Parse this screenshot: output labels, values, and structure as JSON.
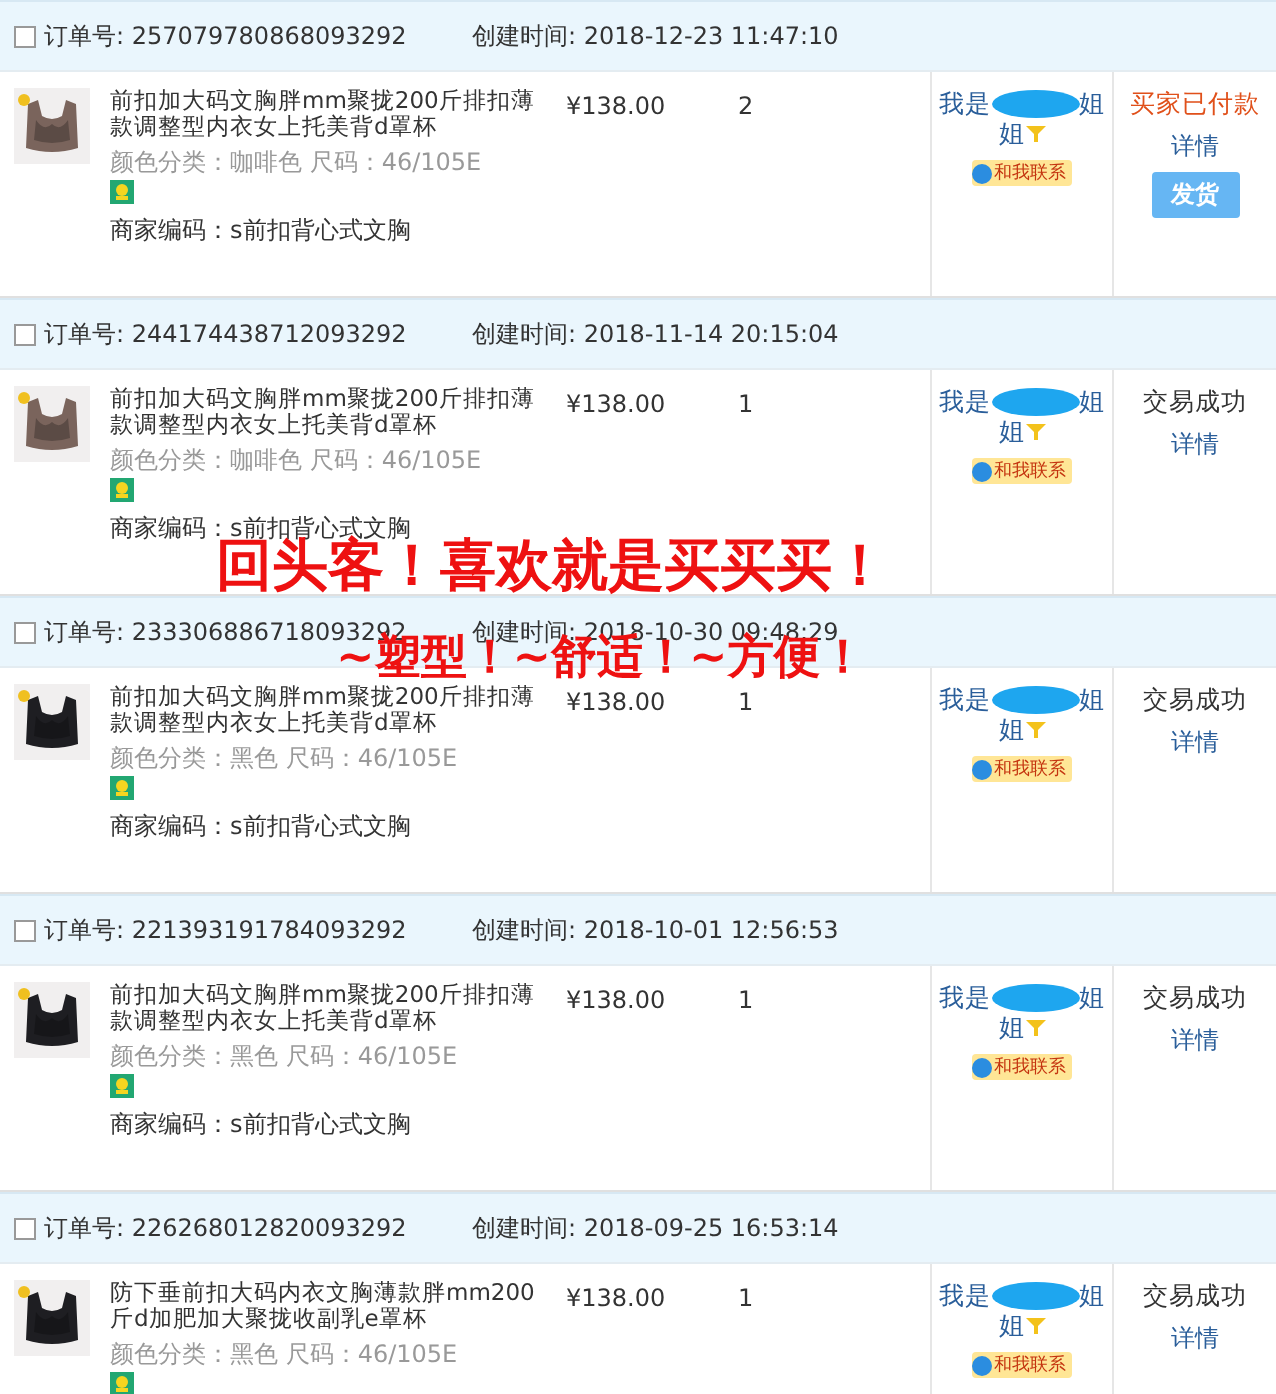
{
  "orders": [
    {
      "checked": false,
      "order_label": "订单号:",
      "order_no": "257079780868093292",
      "created_label": "创建时间:",
      "created": "2018-12-23 11:47:10",
      "product": {
        "title": "前扣加大码文胸胖mm聚拢200斤排扣薄款调整型内衣女上托美背d罩杯",
        "color": "#7a645c",
        "spec": "颜色分类：咖啡色  尺码：46/105E",
        "merchant_code": "商家编码：s前扣背心式文胸"
      },
      "price": "¥138.00",
      "qty": "2",
      "buyer": {
        "prefix": "我是",
        "suffix": "姐",
        "line2": "姐",
        "contact": "和我联系"
      },
      "status": {
        "kind": "paid",
        "text": "买家已付款",
        "detail": "详情",
        "action": "发货"
      }
    },
    {
      "checked": false,
      "order_label": "订单号:",
      "order_no": "244174438712093292",
      "created_label": "创建时间:",
      "created": "2018-11-14 20:15:04",
      "product": {
        "title": "前扣加大码文胸胖mm聚拢200斤排扣薄款调整型内衣女上托美背d罩杯",
        "color": "#7a645c",
        "spec": "颜色分类：咖啡色  尺码：46/105E",
        "merchant_code": "商家编码：s前扣背心式文胸"
      },
      "price": "¥138.00",
      "qty": "1",
      "buyer": {
        "prefix": "我是",
        "suffix": "姐",
        "line2": "姐",
        "contact": "和我联系"
      },
      "status": {
        "kind": "done",
        "text": "交易成功",
        "detail": "详情"
      }
    },
    {
      "checked": false,
      "order_label": "订单号:",
      "order_no": "233306886718093292",
      "created_label": "创建时间:",
      "created": "2018-10-30 09:48:29",
      "product": {
        "title": "前扣加大码文胸胖mm聚拢200斤排扣薄款调整型内衣女上托美背d罩杯",
        "color": "#1e1e22",
        "spec": "颜色分类：黑色  尺码：46/105E",
        "merchant_code": "商家编码：s前扣背心式文胸"
      },
      "price": "¥138.00",
      "qty": "1",
      "buyer": {
        "prefix": "我是",
        "suffix": "姐",
        "line2": "姐",
        "contact": "和我联系"
      },
      "status": {
        "kind": "done",
        "text": "交易成功",
        "detail": "详情"
      }
    },
    {
      "checked": false,
      "order_label": "订单号:",
      "order_no": "221393191784093292",
      "created_label": "创建时间:",
      "created": "2018-10-01 12:56:53",
      "product": {
        "title": "前扣加大码文胸胖mm聚拢200斤排扣薄款调整型内衣女上托美背d罩杯",
        "color": "#1e1e22",
        "spec": "颜色分类：黑色  尺码：46/105E",
        "merchant_code": "商家编码：s前扣背心式文胸"
      },
      "price": "¥138.00",
      "qty": "1",
      "buyer": {
        "prefix": "我是",
        "suffix": "姐",
        "line2": "姐",
        "contact": "和我联系"
      },
      "status": {
        "kind": "done",
        "text": "交易成功",
        "detail": "详情"
      }
    },
    {
      "checked": false,
      "order_label": "订单号:",
      "order_no": "226268012820093292",
      "created_label": "创建时间:",
      "created": "2018-09-25 16:53:14",
      "product": {
        "title": "防下垂前扣大码内衣文胸薄款胖mm200斤d加肥加大聚拢收副乳e罩杯",
        "color": "#1e1e22",
        "spec": "颜色分类：黑色  尺码：46/105E"
      },
      "price": "¥138.00",
      "qty": "1",
      "buyer": {
        "prefix": "我是",
        "suffix": "姐",
        "line2": "姐",
        "contact": "和我联系"
      },
      "status": {
        "kind": "done",
        "text": "交易成功",
        "detail": "详情"
      }
    }
  ],
  "overlay": {
    "line1": "回头客！喜欢就是买买买！",
    "line2": "~塑型！~舒适！~方便！"
  }
}
